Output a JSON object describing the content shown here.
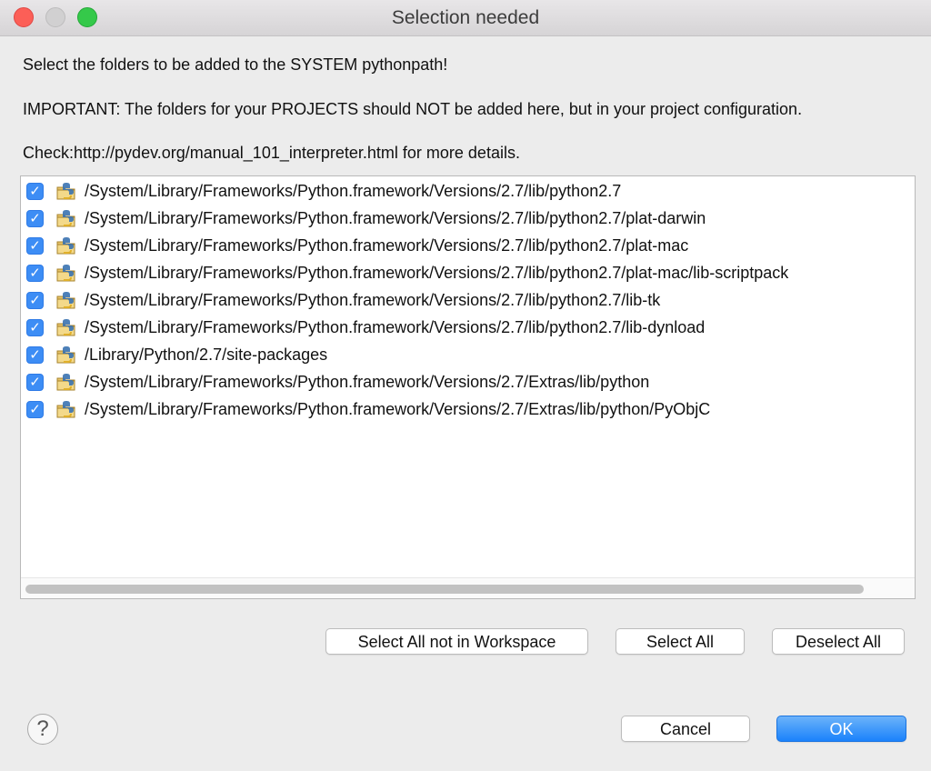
{
  "window": {
    "title": "Selection needed"
  },
  "messages": {
    "line1": "Select the folders to be added to the SYSTEM pythonpath!",
    "line2": "IMPORTANT: The folders for your PROJECTS should NOT be added here, but in your project configuration.",
    "line3": "Check:http://pydev.org/manual_101_interpreter.html for more details."
  },
  "folders": [
    {
      "path": "/System/Library/Frameworks/Python.framework/Versions/2.7/lib/python2.7",
      "checked": true
    },
    {
      "path": "/System/Library/Frameworks/Python.framework/Versions/2.7/lib/python2.7/plat-darwin",
      "checked": true
    },
    {
      "path": "/System/Library/Frameworks/Python.framework/Versions/2.7/lib/python2.7/plat-mac",
      "checked": true
    },
    {
      "path": "/System/Library/Frameworks/Python.framework/Versions/2.7/lib/python2.7/plat-mac/lib-scriptpack",
      "checked": true
    },
    {
      "path": "/System/Library/Frameworks/Python.framework/Versions/2.7/lib/python2.7/lib-tk",
      "checked": true
    },
    {
      "path": "/System/Library/Frameworks/Python.framework/Versions/2.7/lib/python2.7/lib-dynload",
      "checked": true
    },
    {
      "path": "/Library/Python/2.7/site-packages",
      "checked": true
    },
    {
      "path": "/System/Library/Frameworks/Python.framework/Versions/2.7/Extras/lib/python",
      "checked": true
    },
    {
      "path": "/System/Library/Frameworks/Python.framework/Versions/2.7/Extras/lib/python/PyObjC",
      "checked": true
    }
  ],
  "icons": {
    "checkbox": "checkmark-icon",
    "folder": "python-folder-icon",
    "help": "question-mark-icon"
  },
  "buttons": {
    "select_not_in_workspace": "Select All not in Workspace",
    "select_all": "Select All",
    "deselect_all": "Deselect All",
    "cancel": "Cancel",
    "ok": "OK",
    "help": "?"
  },
  "colors": {
    "accent": "#3d8df5",
    "close": "#fc5f57",
    "maximize": "#35c94a",
    "minimize_inactive": "#d1d0d1"
  }
}
